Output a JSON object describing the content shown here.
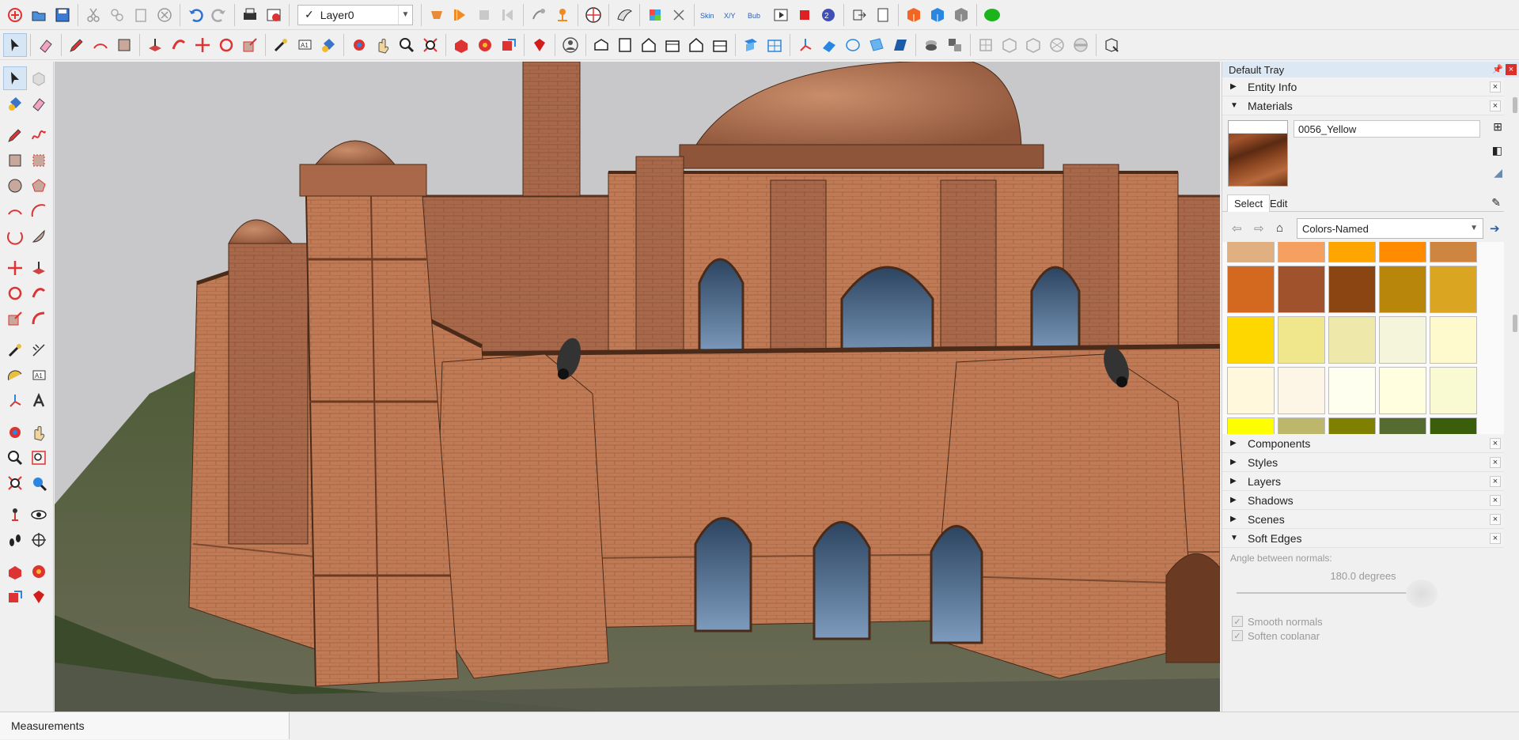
{
  "toolbar": {
    "layer_label": "Layer0",
    "layer_check": "✓",
    "row1_icons": [
      "getting-started-icon",
      "open-icon",
      "save-icon",
      "cut-icon",
      "copy-icon",
      "paste-icon",
      "erase-icon",
      "undo-icon",
      "redo-icon",
      "print-icon",
      "model-info-icon"
    ],
    "row1_icons_b": [
      "previous-scene-icon",
      "play-icon",
      "stop-icon",
      "rewind-icon",
      "walk-icon",
      "position-camera-icon",
      "globe-icon",
      "sandbox-icon",
      "color-icon",
      "xray-icon",
      "skin-icon",
      "xyz-icon",
      "bub-icon",
      "movie-icon",
      "record-icon",
      "sketchup-extension-icon",
      "export-icon",
      "document-icon",
      "cube-orange-icon",
      "cube-blue-icon",
      "cube-gray-icon",
      "green-blob-icon"
    ],
    "row2_icons": [
      "select-icon",
      "eraser-icon",
      "pencil-icon",
      "arc-icon",
      "rectangle-icon",
      "push-pull-icon",
      "follow-me-icon",
      "move-icon",
      "rotate-icon",
      "scale-icon",
      "tape-measure-icon",
      "text-icon",
      "paint-bucket-icon",
      "orbit-icon",
      "pan-icon",
      "zoom-icon",
      "zoom-extents-icon",
      "3d-warehouse-icon",
      "extension-warehouse-icon",
      "send-to-layout-icon",
      "ruby-icon",
      "account-icon",
      "iso-view-icon",
      "top-view-icon",
      "front-view-icon",
      "right-view-icon",
      "back-view-icon",
      "left-view-icon",
      "section-plane-icon",
      "section-cut-icon",
      "axes-icon",
      "guides-icon",
      "wireframe-icon",
      "hidden-line-icon",
      "shaded-icon",
      "shaded-texture-icon",
      "monochrome-icon",
      "xray-view-icon",
      "back-edges-icon",
      "shadows-icon",
      "fog-icon",
      "edge-style-icon",
      "profiles-icon",
      "depth-cue-icon",
      "extension-icon"
    ]
  },
  "viewport": {
    "scene": "brick-fortress-model"
  },
  "status": {
    "measurements_label": "Measurements"
  },
  "tray": {
    "title": "Default Tray",
    "panels_top": [
      {
        "label": "Entity Info",
        "expanded": false
      },
      {
        "label": "Materials",
        "expanded": true
      }
    ],
    "materials": {
      "name": "0056_Yellow",
      "tabs": [
        "Select",
        "Edit"
      ],
      "collection": "Colors-Named",
      "swatch_rows": [
        [
          "#e0b080",
          "#f5a060",
          "#ffa500",
          "#ff8c00",
          "#cd853f"
        ],
        [
          "#d2691e",
          "#a0522d",
          "#8b4513",
          "#b8860b",
          "#daa520"
        ],
        [
          "#ffd700",
          "#f0e68c",
          "#eee8aa",
          "#f5f5dc",
          "#fffacd"
        ],
        [
          "#fff8dc",
          "#fdf5e6",
          "#fffff0",
          "#ffffe0",
          "#fafad2"
        ],
        [
          "#ffff00",
          "#bdb76b",
          "#808000",
          "#556b2f",
          "#3b5e0c"
        ],
        [
          "#6b8e23",
          "#9acd32",
          "#adff2f",
          "#7cfc00",
          "#00ff00"
        ]
      ]
    },
    "panels_bottom": [
      {
        "label": "Components",
        "expanded": false
      },
      {
        "label": "Styles",
        "expanded": false
      },
      {
        "label": "Layers",
        "expanded": false
      },
      {
        "label": "Shadows",
        "expanded": false
      },
      {
        "label": "Scenes",
        "expanded": false
      },
      {
        "label": "Soft Edges",
        "expanded": true
      }
    ],
    "soft_edges": {
      "angle_label": "Angle between normals:",
      "angle_value": "180.0  degrees",
      "smooth_normals": "Smooth normals",
      "soften_coplanar": "Soften coplanar"
    }
  },
  "colors": {
    "accent": "#0078d7",
    "close_red": "#d9302b",
    "tray_title_bg": "#dde8f5",
    "brick": "#c07a55"
  }
}
